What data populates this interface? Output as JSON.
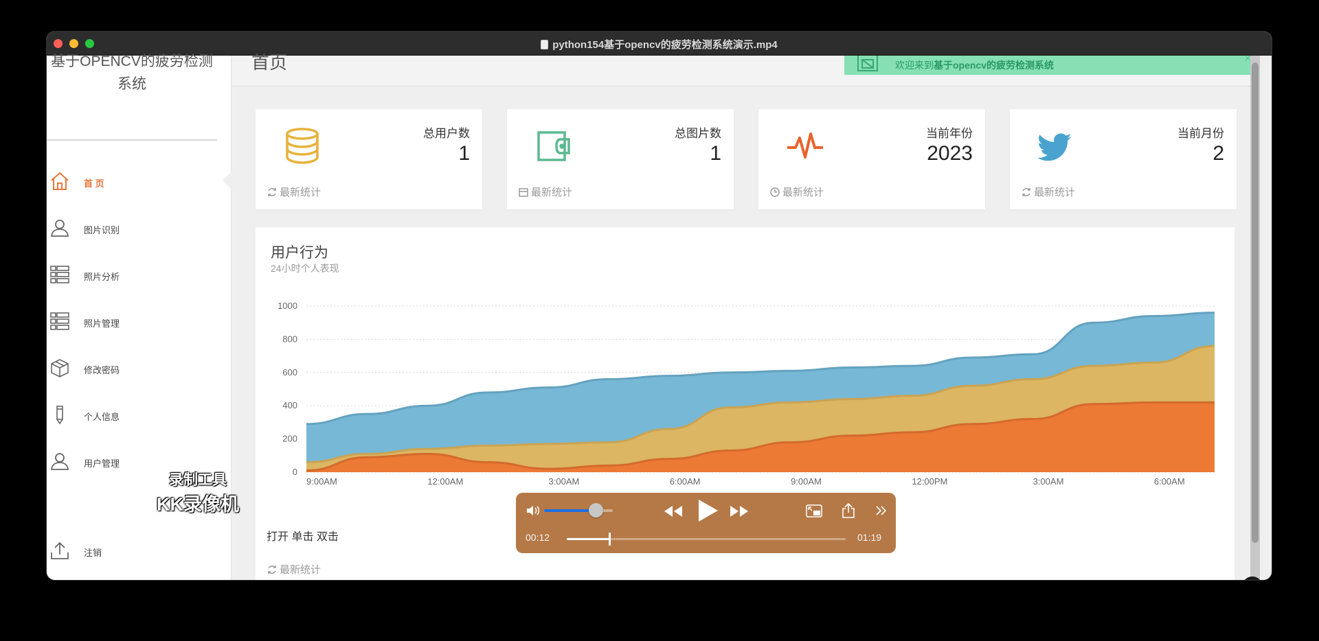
{
  "window": {
    "title": "python154基于opencv的疲劳检测系统演示.mp4"
  },
  "sidebar": {
    "brand_line1": "基于OPENCV的疲劳检测",
    "brand_line2": "系统",
    "items": [
      {
        "label": "首 页",
        "icon": "home-icon",
        "active": true
      },
      {
        "label": "图片识别",
        "icon": "user-icon"
      },
      {
        "label": "照片分析",
        "icon": "list-icon"
      },
      {
        "label": "照片管理",
        "icon": "list-icon"
      },
      {
        "label": "修改密码",
        "icon": "box-icon"
      },
      {
        "label": "个人信息",
        "icon": "pencil-icon"
      },
      {
        "label": "用户管理",
        "icon": "user-icon"
      }
    ],
    "logout_label": "注销",
    "watermark_line1": "录制工具",
    "watermark_line2": "KK录像机"
  },
  "header": {
    "page_title": "首页",
    "welcome_prefix": "欢迎来到",
    "welcome_name": "基于opencv的疲劳检测系统",
    "close_glyph": "×"
  },
  "stats": [
    {
      "label": "总用户数",
      "value": "1",
      "footer": "最新统计",
      "icon": "database-icon",
      "color": "#e8b23a"
    },
    {
      "label": "总图片数",
      "value": "1",
      "footer": "最新统计",
      "icon": "wallet-icon",
      "color": "#5bb88f"
    },
    {
      "label": "当前年份",
      "value": "2023",
      "footer": "最新统计",
      "icon": "pulse-icon",
      "color": "#e8632f"
    },
    {
      "label": "当前月份",
      "value": "2",
      "footer": "最新统计",
      "icon": "twitter-icon",
      "color": "#4aa3cf"
    }
  ],
  "panel": {
    "title": "用户行为",
    "subtitle": "24小时个人表现",
    "legend_text": "打开 单击 双击",
    "footer": "最新统计"
  },
  "chart_data": {
    "type": "area",
    "stacked": false,
    "ylim": [
      0,
      1000
    ],
    "yticks": [
      0,
      200,
      400,
      600,
      800,
      1000
    ],
    "x_tick_labels": [
      "9:00AM",
      "12:00AM",
      "3:00AM",
      "6:00AM",
      "9:00AM",
      "12:00PM",
      "3:00AM",
      "6:00AM"
    ],
    "x_tick_positions": [
      0,
      2,
      4,
      6,
      8,
      10,
      12,
      14
    ],
    "grid": true,
    "series": [
      {
        "values": [
          290,
          350,
          400,
          480,
          510,
          560,
          580,
          600,
          610,
          630,
          640,
          690,
          710,
          900,
          940,
          960
        ],
        "color": "#6fb4d4"
      },
      {
        "values": [
          60,
          110,
          140,
          160,
          170,
          180,
          260,
          390,
          420,
          440,
          460,
          520,
          560,
          640,
          660,
          760
        ],
        "color": "#e2b55c"
      },
      {
        "values": [
          10,
          90,
          110,
          60,
          20,
          40,
          80,
          130,
          180,
          220,
          240,
          290,
          320,
          410,
          420,
          420
        ],
        "color": "#ec7632"
      }
    ],
    "x_count": 16
  },
  "player": {
    "current_time": "00:12",
    "total_time": "01:19",
    "progress": 0.152,
    "volume": 0.75,
    "accent": "#1f6fe0"
  }
}
